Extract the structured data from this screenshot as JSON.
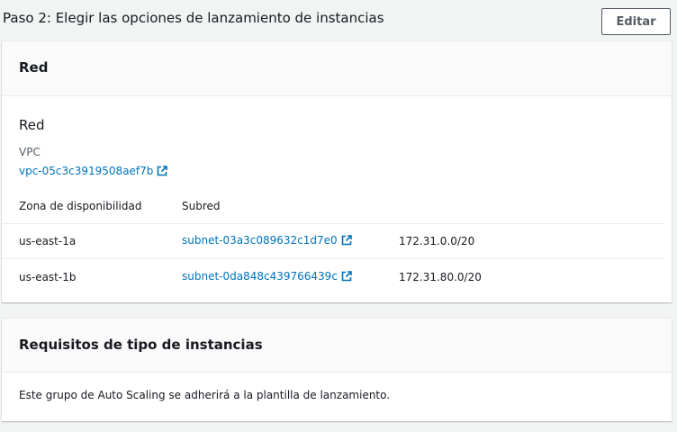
{
  "step": {
    "title": "Paso 2: Elegir las opciones de lanzamiento de instancias",
    "edit_label": "Editar"
  },
  "network_panel": {
    "header": "Red",
    "section_title": "Red",
    "vpc_label": "VPC",
    "vpc_value": "vpc-05c3c3919508aef7b",
    "table": {
      "headers": [
        "Zona de disponibilidad",
        "Subred"
      ],
      "rows": [
        {
          "zone": "us-east-1a",
          "subnet": "subnet-03a3c089632c1d7e0",
          "cidr": "172.31.0.0/20"
        },
        {
          "zone": "us-east-1b",
          "subnet": "subnet-0da848c439766439c",
          "cidr": "172.31.80.0/20"
        }
      ]
    }
  },
  "instance_panel": {
    "header": "Requisitos de tipo de instancias",
    "body": "Este grupo de Auto Scaling se adherirá a la plantilla de lanzamiento."
  },
  "icons": {
    "external_link": "external-link-icon"
  },
  "colors": {
    "link": "#0073bb",
    "background": "#f2f3f3"
  }
}
